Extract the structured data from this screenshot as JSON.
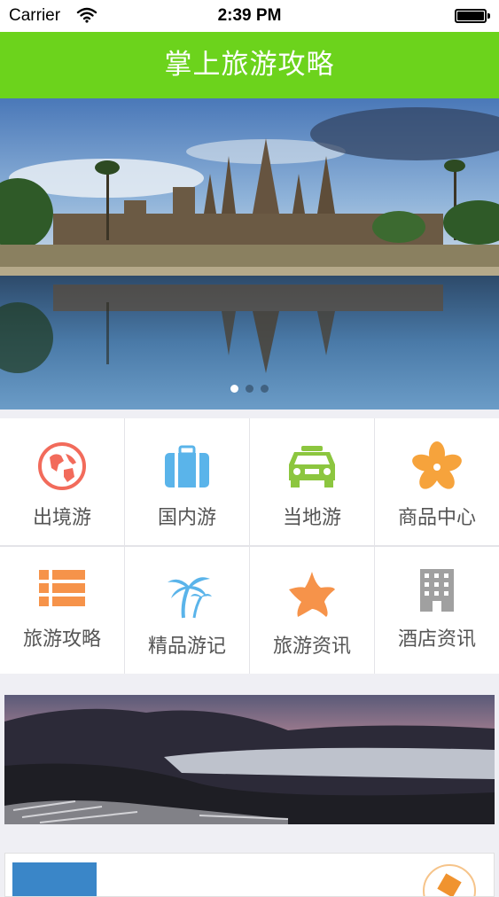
{
  "status_bar": {
    "carrier": "Carrier",
    "time": "2:39 PM"
  },
  "nav": {
    "title": "掌上旅游攻略"
  },
  "hero": {
    "image": "angkor-temple-photo",
    "page_count": 3,
    "current_page": 1
  },
  "grid": {
    "items": [
      {
        "label": "出境游",
        "icon": "globe-icon",
        "color": "#f26b5b"
      },
      {
        "label": "国内游",
        "icon": "suitcase-icon",
        "color": "#5ab4ea"
      },
      {
        "label": "当地游",
        "icon": "car-icon",
        "color": "#8cc63f"
      },
      {
        "label": "商品中心",
        "icon": "flower-icon",
        "color": "#f6a33c"
      },
      {
        "label": "旅游攻略",
        "icon": "list-icon",
        "color": "#f6934a"
      },
      {
        "label": "精品游记",
        "icon": "palm-tree-icon",
        "color": "#5ab4ea"
      },
      {
        "label": "旅游资讯",
        "icon": "starfish-icon",
        "color": "#f6934a"
      },
      {
        "label": "酒店资讯",
        "icon": "building-icon",
        "color": "#a0a0a0"
      }
    ]
  },
  "banner2": {
    "image": "mountain-terraces-photo"
  },
  "colors": {
    "nav_green": "#6cd31c",
    "background": "#efeff4"
  }
}
